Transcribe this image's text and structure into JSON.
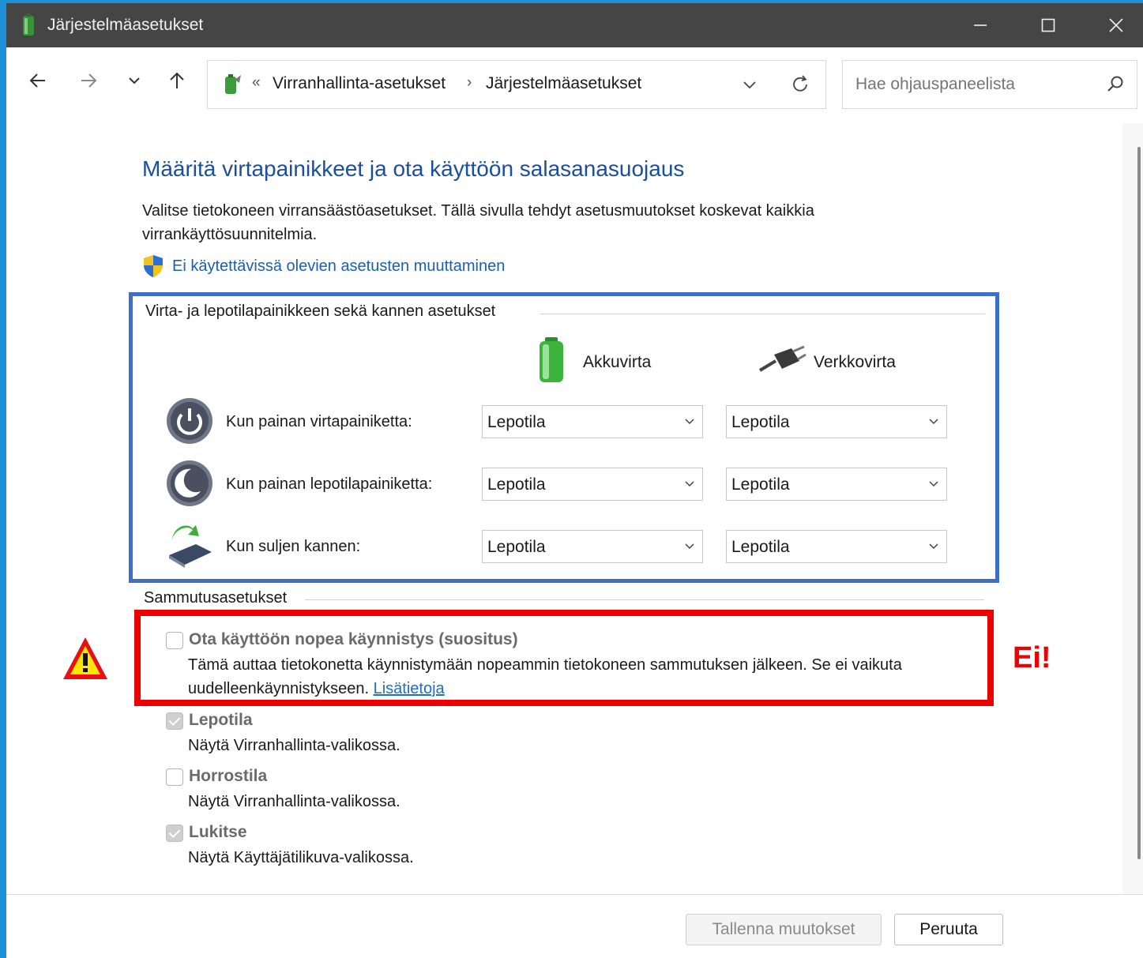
{
  "window": {
    "title": "Järjestelmäasetukset",
    "controls": {
      "minimize": "—",
      "maximize": "☐",
      "close": "✕"
    }
  },
  "toolbar": {
    "back_icon": "arrow-left-icon",
    "forward_icon": "arrow-right-icon",
    "recent_icon": "chevron-down-icon",
    "up_icon": "arrow-up-icon",
    "breadcrumb": {
      "overflow": "«",
      "items": [
        "Virranhallinta-asetukset",
        "Järjestelmäasetukset"
      ],
      "separator": "›"
    },
    "search": {
      "placeholder": "Hae ohjauspaneelista"
    }
  },
  "main": {
    "heading": "Määritä virtapainikkeet ja ota käyttöön salasanasuojaus",
    "description": "Valitse tietokoneen virransäästöasetukset. Tällä sivulla tehdyt asetusmuutokset koskevat kaikkia virrankäyttösuunnitelmia.",
    "admin_link": "Ei käytettävissä olevien asetusten muuttaminen",
    "buttons_group": {
      "title": "Virta- ja lepotilapainikkeen sekä kannen asetukset",
      "col_battery": "Akkuvirta",
      "col_plugged": "Verkkovirta",
      "rows": [
        {
          "label": "Kun painan virtapainiketta:",
          "battery": "Lepotila",
          "plugged": "Lepotila"
        },
        {
          "label": "Kun painan lepotilapainiketta:",
          "battery": "Lepotila",
          "plugged": "Lepotila"
        },
        {
          "label": "Kun suljen kannen:",
          "battery": "Lepotila",
          "plugged": "Lepotila"
        }
      ]
    },
    "shutdown_group": {
      "title": "Sammutusasetukset",
      "options": [
        {
          "label": "Ota käyttöön nopea käynnistys (suositus)",
          "desc": "Tämä auttaa tietokonetta käynnistymään nopeammin tietokoneen sammutuksen jälkeen. Se ei vaikuta uudelleenkäynnistykseen.",
          "link": "Lisätietoja",
          "checked": false
        },
        {
          "label": "Lepotila",
          "desc": "Näytä Virranhallinta-valikossa.",
          "checked": true
        },
        {
          "label": "Horrostila",
          "desc": "Näytä Virranhallinta-valikossa.",
          "checked": false
        },
        {
          "label": "Lukitse",
          "desc": "Näytä Käyttäjätilikuva-valikossa.",
          "checked": true
        }
      ]
    },
    "annotation": {
      "text": "Ei!",
      "color": "#ee0000"
    }
  },
  "footer": {
    "save": "Tallenna muutokset",
    "cancel": "Peruuta"
  },
  "colors": {
    "heading": "#1a4e9e",
    "link": "#1a5fb4",
    "highlight_blue": "#3d6fc8",
    "highlight_red": "#ee0000",
    "titlebar": "#454545"
  }
}
